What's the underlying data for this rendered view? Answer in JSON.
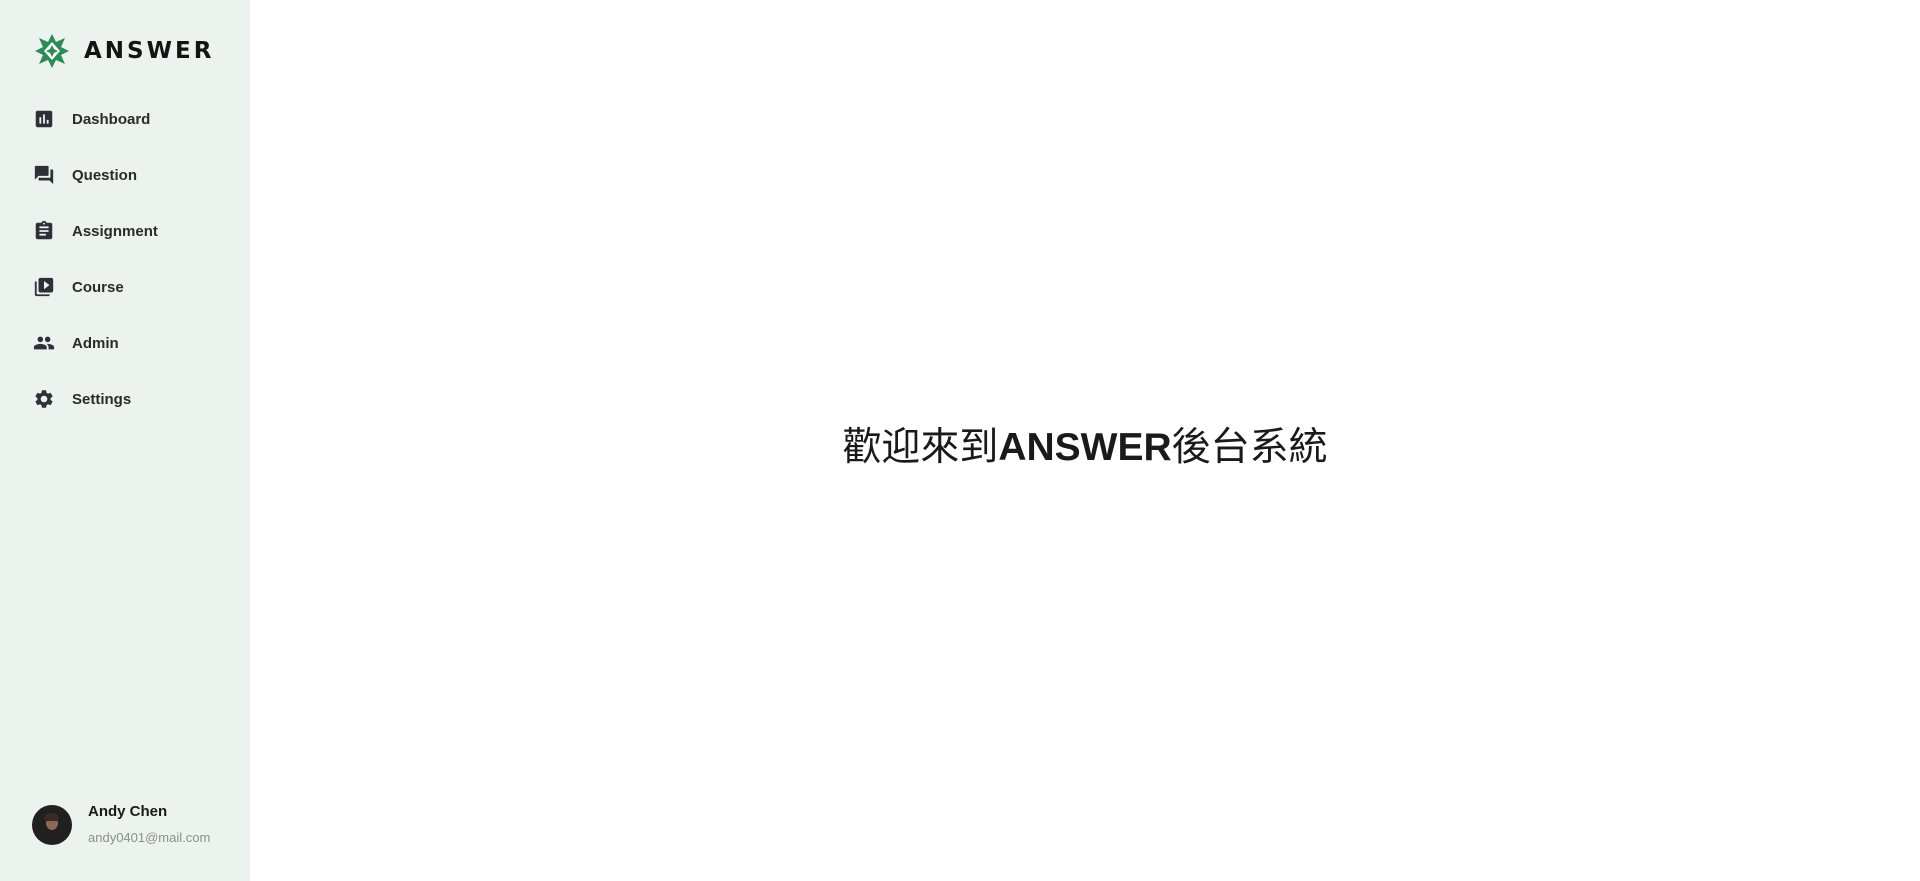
{
  "brand": {
    "name": "ANSWER",
    "logo_icon": "answer-logo-icon",
    "accent_color": "#2e8b57"
  },
  "sidebar": {
    "background": "#ecf3ee",
    "items": [
      {
        "label": "Dashboard",
        "icon": "bar-chart-icon"
      },
      {
        "label": "Question",
        "icon": "forum-icon"
      },
      {
        "label": "Assignment",
        "icon": "clipboard-icon"
      },
      {
        "label": "Course",
        "icon": "video-library-icon"
      },
      {
        "label": "Admin",
        "icon": "people-icon"
      },
      {
        "label": "Settings",
        "icon": "gear-icon"
      }
    ]
  },
  "user": {
    "name": "Andy Chen",
    "email": "andy0401@mail.com"
  },
  "main": {
    "welcome_pre": "歡迎來到",
    "welcome_brand": "ANSWER",
    "welcome_post": "後台系統"
  }
}
